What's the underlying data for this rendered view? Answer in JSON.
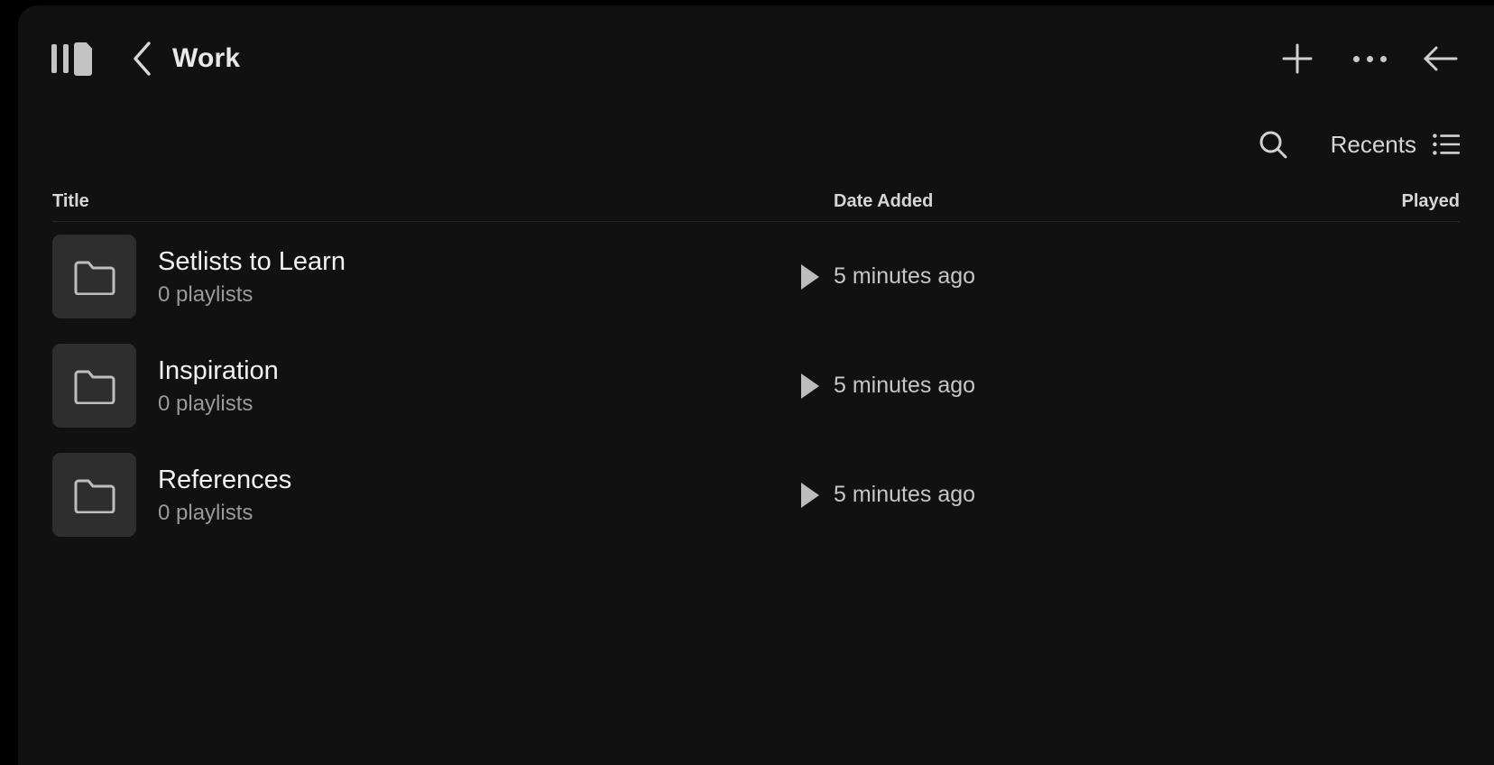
{
  "window": {
    "background": "#111111",
    "outside_background": "#000000"
  },
  "header": {
    "logo_name": "app-logo",
    "back_label": "Back",
    "title": "Work",
    "actions": [
      {
        "name": "add-button",
        "icon": "plus-icon",
        "label": "Add"
      },
      {
        "name": "more-options-button",
        "icon": "ellipsis-icon",
        "label": "More options"
      },
      {
        "name": "back-arrow-button",
        "icon": "arrow-left-icon",
        "label": "Back"
      }
    ]
  },
  "toolbar": {
    "search_label": "Search",
    "search_icon": "search-icon",
    "sort_label": "Recents",
    "view_icon": "list-view-icon"
  },
  "table": {
    "columns": [
      {
        "key": "title",
        "label": "Title"
      },
      {
        "key": "date",
        "label": "Date Added"
      },
      {
        "key": "played",
        "label": "Played"
      }
    ],
    "rows": [
      {
        "icon": "folder-icon",
        "title": "Setlists to Learn",
        "subtitle": "0 playlists",
        "date_added": "5 minutes ago",
        "played": "",
        "has_play_indicator": true
      },
      {
        "icon": "folder-icon",
        "title": "Inspiration",
        "subtitle": "0 playlists",
        "date_added": "5 minutes ago",
        "played": "",
        "has_play_indicator": true
      },
      {
        "icon": "folder-icon",
        "title": "References",
        "subtitle": "0 playlists",
        "date_added": "5 minutes ago",
        "played": "",
        "has_play_indicator": true
      }
    ]
  },
  "colors": {
    "surface": "#111111",
    "thumbnail": "#2e2e2e",
    "primary_text": "#f2f2f2",
    "secondary_text": "#9a9a9a",
    "icon": "#c9c9c9",
    "divider": "#242424"
  }
}
